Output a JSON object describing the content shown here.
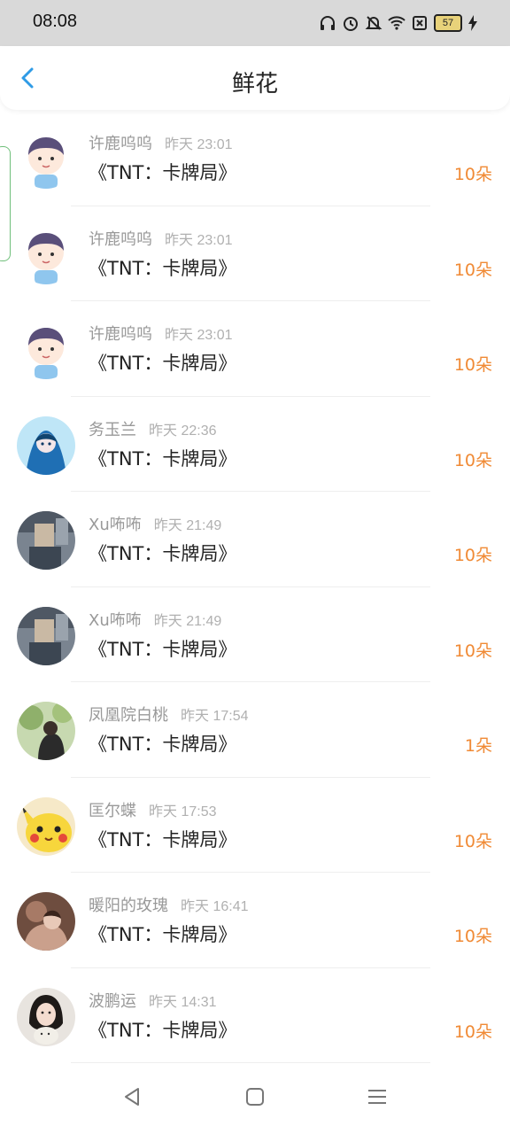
{
  "status": {
    "time": "08:08",
    "battery": "57"
  },
  "header": {
    "title": "鲜花"
  },
  "rows": [
    {
      "name": "许鹿呜呜",
      "time": "昨天 23:01",
      "work": "《TNT：卡牌局》",
      "count": "10朵",
      "avatar": "cartoon-boy-avatar"
    },
    {
      "name": "许鹿呜呜",
      "time": "昨天 23:01",
      "work": "《TNT：卡牌局》",
      "count": "10朵",
      "avatar": "cartoon-boy-avatar"
    },
    {
      "name": "许鹿呜呜",
      "time": "昨天 23:01",
      "work": "《TNT：卡牌局》",
      "count": "10朵",
      "avatar": "cartoon-boy-avatar"
    },
    {
      "name": "务玉兰",
      "time": "昨天 22:36",
      "work": "《TNT：卡牌局》",
      "count": "10朵",
      "avatar": "blue-anime-avatar"
    },
    {
      "name": "Xu咘咘",
      "time": "昨天 21:49",
      "work": "《TNT：卡牌局》",
      "count": "10朵",
      "avatar": "photo-avatar"
    },
    {
      "name": "Xu咘咘",
      "time": "昨天 21:49",
      "work": "《TNT：卡牌局》",
      "count": "10朵",
      "avatar": "photo-avatar"
    },
    {
      "name": "凤凰院白桃",
      "time": "昨天 17:54",
      "work": "《TNT：卡牌局》",
      "count": "1朵",
      "avatar": "green-photo-avatar"
    },
    {
      "name": "匡尔蝶",
      "time": "昨天 17:53",
      "work": "《TNT：卡牌局》",
      "count": "10朵",
      "avatar": "pikachu-avatar"
    },
    {
      "name": "暖阳的玫瑰",
      "time": "昨天 16:41",
      "work": "《TNT：卡牌局》",
      "count": "10朵",
      "avatar": "brown-photo-avatar"
    },
    {
      "name": "波鹏运",
      "time": "昨天 14:31",
      "work": "《TNT：卡牌局》",
      "count": "10朵",
      "avatar": "girl-photo-avatar"
    }
  ],
  "colors": {
    "accent": "#f08a35",
    "back": "#2f9be6"
  }
}
